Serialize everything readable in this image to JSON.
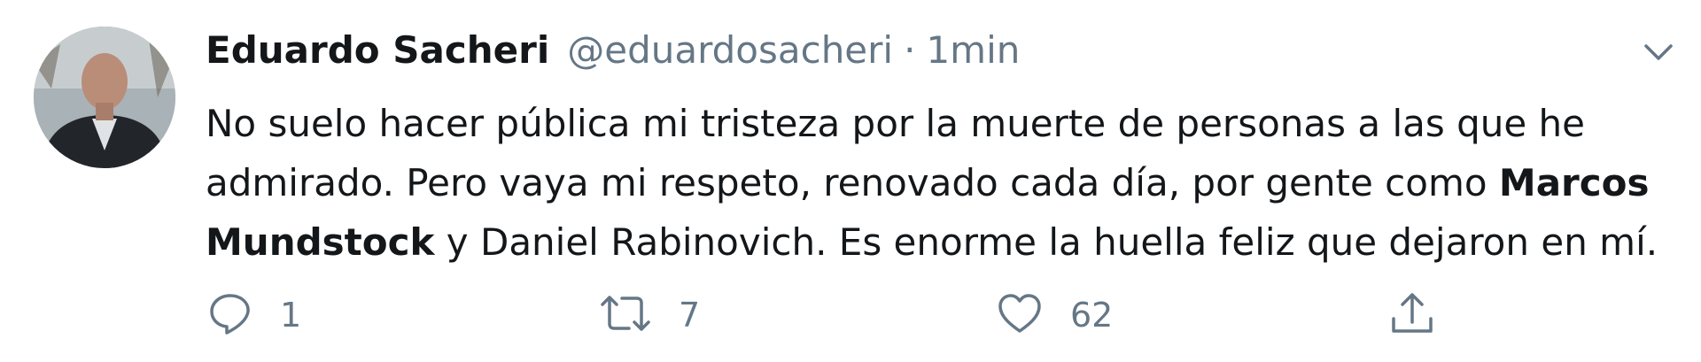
{
  "tweet": {
    "author_name": "Eduardo Sacheri",
    "handle": "@eduardosacheri",
    "separator": "·",
    "time": "1min",
    "text_part1": "No suelo hacer pública mi tristeza por la muerte de personas a las que he admirado. Pero vaya mi respeto, renovado cada día, por gente como ",
    "text_bold": "Marcos Mundstock",
    "text_part2": " y Daniel Rabinovich. Es enorme la huella feliz que dejaron en mí."
  },
  "actions": {
    "reply_count": "1",
    "retweet_count": "7",
    "like_count": "62"
  },
  "icons": {
    "reply": "reply-icon",
    "retweet": "retweet-icon",
    "like": "heart-icon",
    "share": "share-icon",
    "menu": "chevron-down-icon"
  },
  "colors": {
    "text": "#14171a",
    "secondary": "#657786",
    "background": "#ffffff"
  }
}
